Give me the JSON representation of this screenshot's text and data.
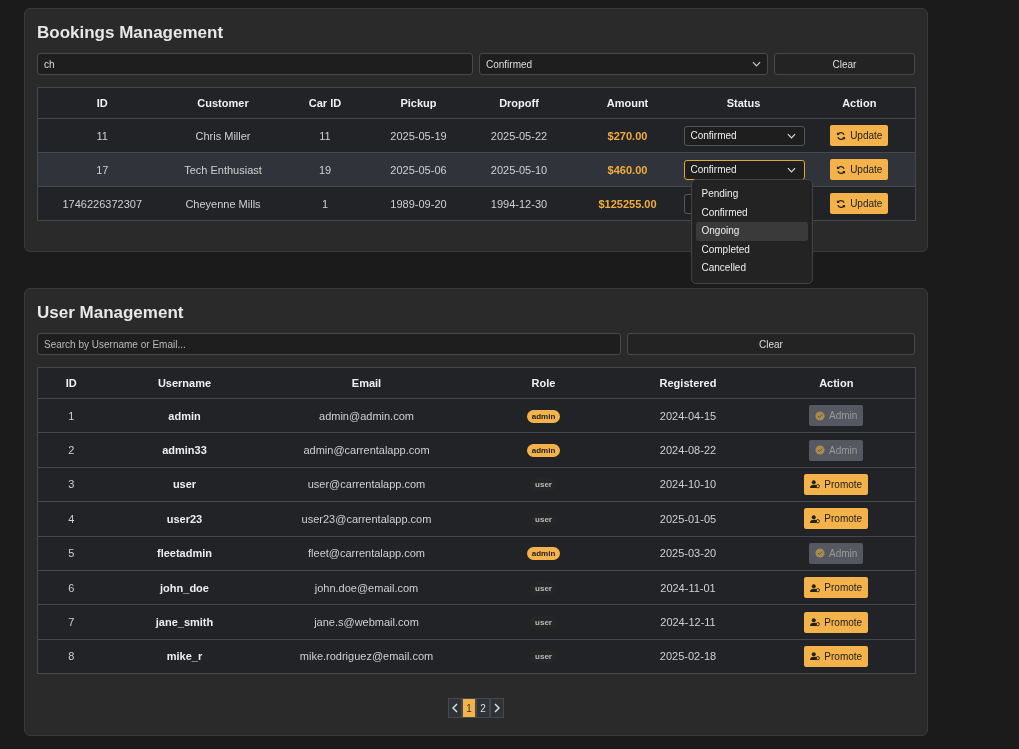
{
  "bookings": {
    "title": "Bookings Management",
    "search": {
      "value": "ch"
    },
    "filter": {
      "value": "Confirmed"
    },
    "clear_button": "Clear",
    "columns": [
      "ID",
      "Customer",
      "Car ID",
      "Pickup",
      "Dropoff",
      "Amount",
      "Status",
      "Action"
    ],
    "rows": [
      {
        "id": "11",
        "customer": "Chris Miller",
        "car_id": "11",
        "pickup": "2025-05-19",
        "dropoff": "2025-05-22",
        "amount": "$270.00",
        "status": "Confirmed",
        "open": false,
        "highlighted": false,
        "action": "Update"
      },
      {
        "id": "17",
        "customer": "Tech Enthusiast",
        "car_id": "19",
        "pickup": "2025-05-06",
        "dropoff": "2025-05-10",
        "amount": "$460.00",
        "status": "Confirmed",
        "open": true,
        "highlighted": true,
        "action": "Update",
        "options": [
          {
            "label": "Pending",
            "selected": false
          },
          {
            "label": "Confirmed",
            "selected": false
          },
          {
            "label": "Ongoing",
            "selected": true
          },
          {
            "label": "Completed",
            "selected": false
          },
          {
            "label": "Cancelled",
            "selected": false
          }
        ]
      },
      {
        "id": "1746226372307",
        "customer": "Cheyenne Mills",
        "car_id": "1",
        "pickup": "1989-09-20",
        "dropoff": "1994-12-30",
        "amount": "$125255.00",
        "open": false,
        "highlighted": false,
        "action": "Update"
      }
    ]
  },
  "users": {
    "title": "User Management",
    "search": {
      "placeholder": "Search by Username or Email..."
    },
    "clear_button": "Clear",
    "columns": [
      "ID",
      "Username",
      "Email",
      "Role",
      "Registered",
      "Action"
    ],
    "rows": [
      {
        "id": "1",
        "username": "admin",
        "email": "admin@admin.com",
        "role": "admin",
        "role_highlighted": true,
        "registered": "2024-04-15",
        "action": {
          "label": "Admin",
          "disabled": true
        }
      },
      {
        "id": "2",
        "username": "admin33",
        "email": "admin@carrentalapp.com",
        "role": "admin",
        "role_highlighted": true,
        "registered": "2024-08-22",
        "action": {
          "label": "Admin",
          "disabled": true
        }
      },
      {
        "id": "3",
        "username": "user",
        "email": "user@carrentalapp.com",
        "role": "user",
        "role_highlighted": false,
        "registered": "2024-10-10",
        "action": {
          "label": "Promote",
          "disabled": false
        }
      },
      {
        "id": "4",
        "username": "user23",
        "email": "user23@carrentalapp.com",
        "role": "user",
        "role_highlighted": false,
        "registered": "2025-01-05",
        "action": {
          "label": "Promote",
          "disabled": false
        }
      },
      {
        "id": "5",
        "username": "fleetadmin",
        "email": "fleet@carrentalapp.com",
        "role": "admin",
        "role_highlighted": true,
        "registered": "2025-03-20",
        "action": {
          "label": "Admin",
          "disabled": true
        }
      },
      {
        "id": "6",
        "username": "john_doe",
        "email": "john.doe@email.com",
        "role": "user",
        "role_highlighted": false,
        "registered": "2024-11-01",
        "action": {
          "label": "Promote",
          "disabled": false
        }
      },
      {
        "id": "7",
        "username": "jane_smith",
        "email": "jane.s@webmail.com",
        "role": "user",
        "role_highlighted": false,
        "registered": "2024-12-11",
        "action": {
          "label": "Promote",
          "disabled": false
        }
      },
      {
        "id": "8",
        "username": "mike_r",
        "email": "mike.rodriguez@email.com",
        "role": "user",
        "role_highlighted": false,
        "registered": "2025-02-18",
        "action": {
          "label": "Promote",
          "disabled": false
        }
      }
    ],
    "pagination": {
      "pages": [
        {
          "label": "1",
          "selected": true
        },
        {
          "label": "2",
          "selected": false
        }
      ]
    }
  }
}
